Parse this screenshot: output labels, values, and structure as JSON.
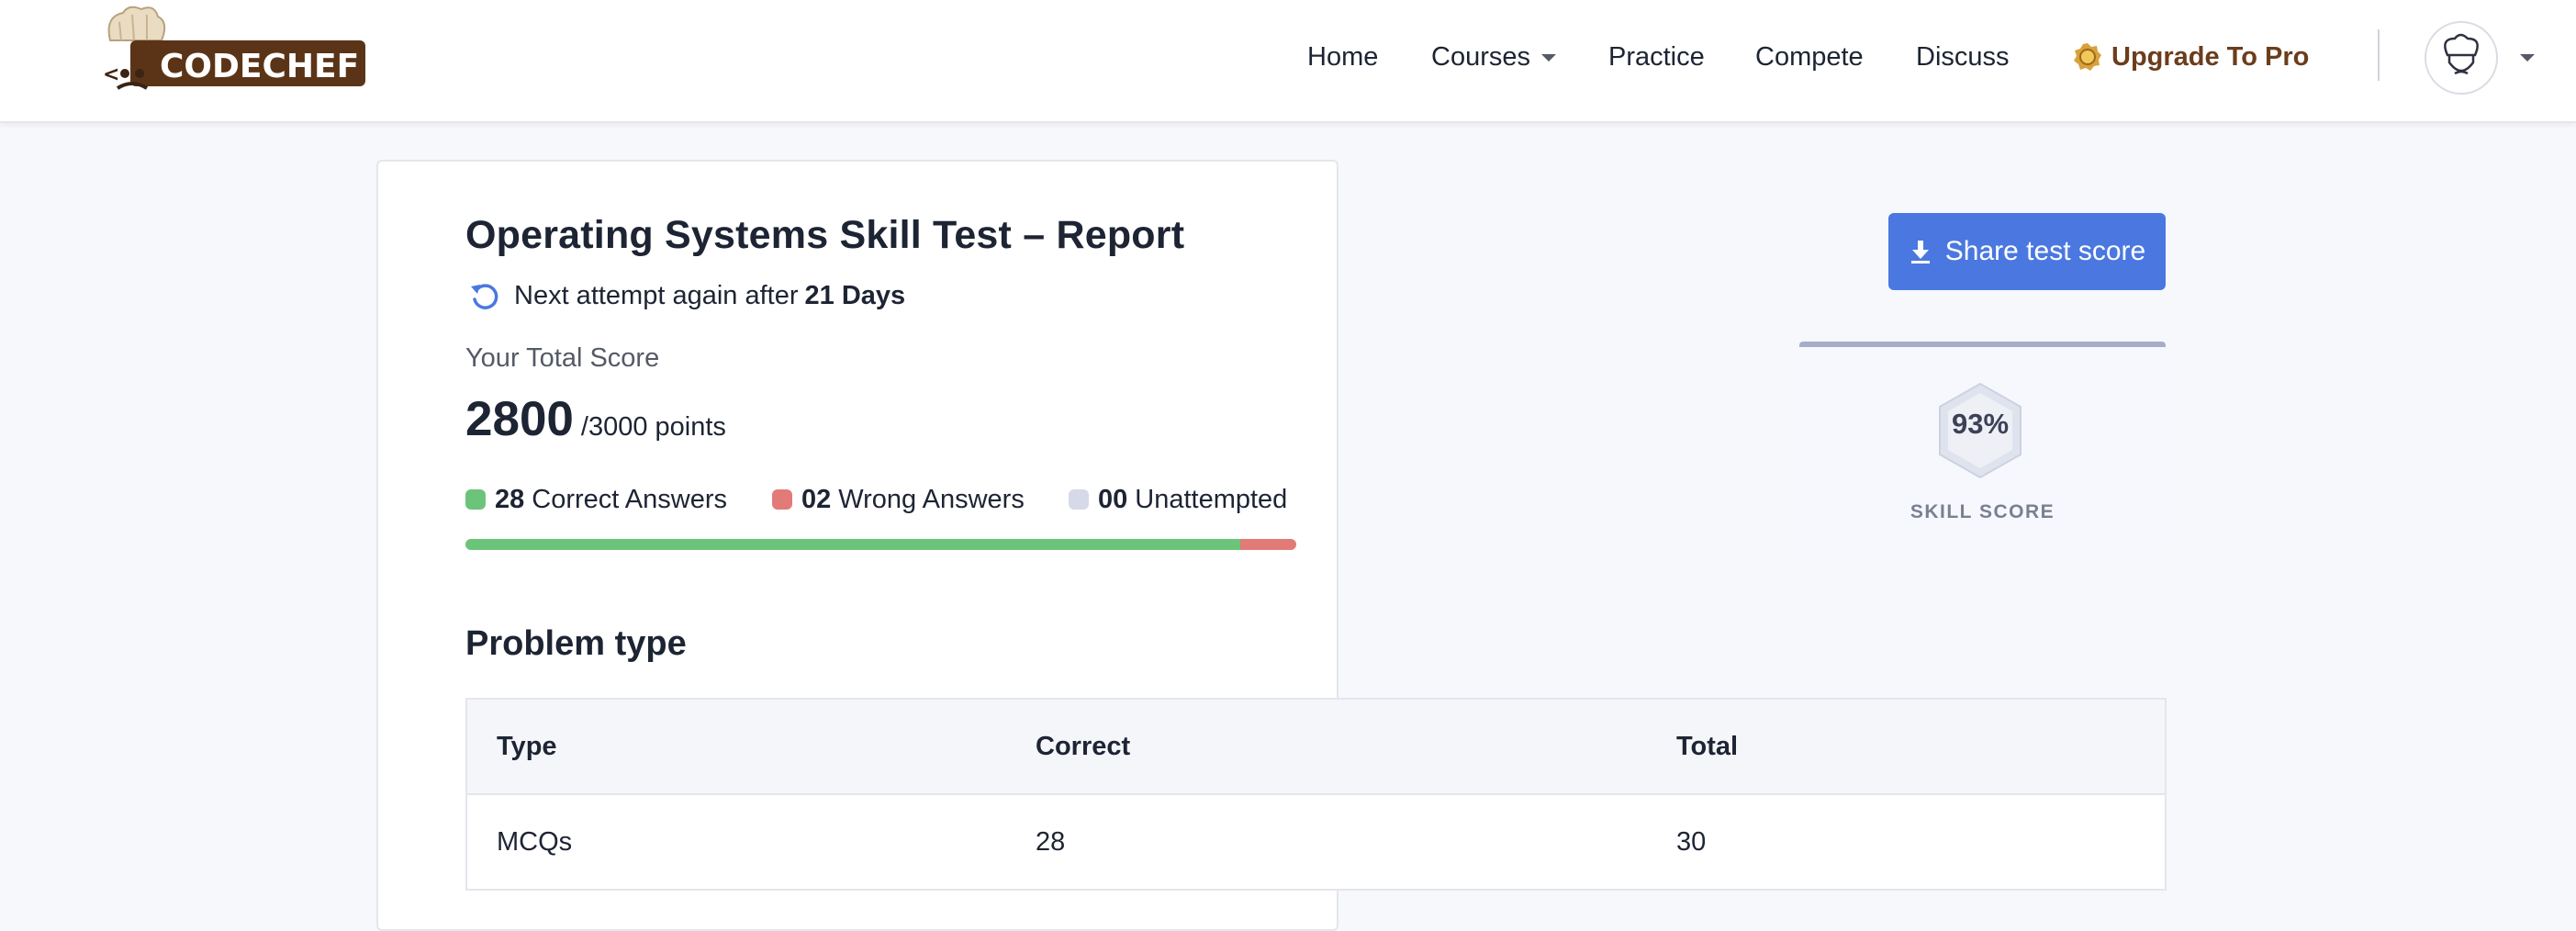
{
  "nav": {
    "logo_text": "CODECHEF",
    "links": [
      "Home",
      "Courses",
      "Practice",
      "Compete",
      "Discuss"
    ],
    "upgrade_label": "Upgrade To Pro"
  },
  "report": {
    "title": "Operating Systems Skill Test – Report",
    "next_attempt_text": "Next attempt again after",
    "next_attempt_value": "21 Days",
    "score_label": "Your Total Score",
    "score": "2800",
    "score_max": "/3000 points",
    "correct_count": "28",
    "correct_label": "Correct Answers",
    "wrong_count": "02",
    "wrong_label": "Wrong Answers",
    "unattempted_count": "00",
    "unattempted_label": "Unattempted",
    "progress_fractions": {
      "correct": 0.933,
      "wrong": 0.067,
      "unattempted": 0.0
    }
  },
  "share": {
    "label": "Share test score"
  },
  "skill": {
    "percent": "93%",
    "caption": "SKILL SCORE"
  },
  "problem_type": {
    "title": "Problem type",
    "headers": [
      "Type",
      "Correct",
      "Total"
    ],
    "rows": [
      [
        "MCQs",
        "28",
        "30"
      ]
    ]
  },
  "colors": {
    "correct": "#6cc47a",
    "wrong": "#e27b78",
    "unattempted": "#d6d9e8",
    "accent": "#4a78e0",
    "brand_brown": "#6b3d1c"
  }
}
